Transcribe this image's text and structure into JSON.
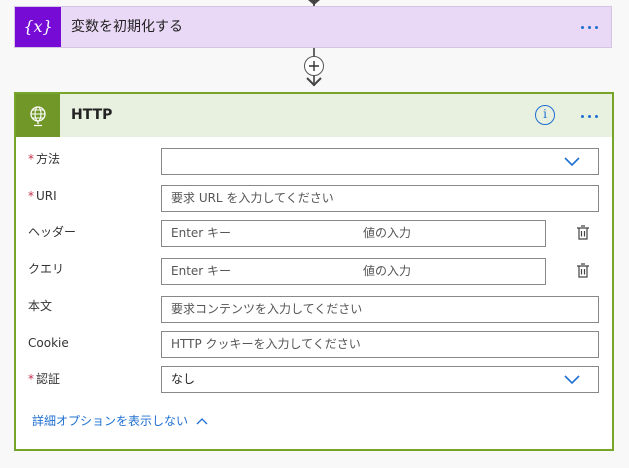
{
  "variable_card": {
    "title": "変数を初期化する",
    "icon": "variable-braces-icon",
    "accent_color": "#770bd6"
  },
  "http_card": {
    "title": "HTTP",
    "icon": "globe-icon",
    "accent_color": "#709727",
    "border_color": "#76a52a",
    "fields": {
      "method": {
        "label": "方法",
        "required": true,
        "value": ""
      },
      "uri": {
        "label": "URI",
        "required": true,
        "placeholder": "要求 URL を入力してください"
      },
      "headers": {
        "label": "ヘッダー",
        "key_placeholder": "Enter キー",
        "value_placeholder": "値の入力"
      },
      "queries": {
        "label": "クエリ",
        "key_placeholder": "Enter キー",
        "value_placeholder": "値の入力"
      },
      "body": {
        "label": "本文",
        "placeholder": "要求コンテンツを入力してください"
      },
      "cookie": {
        "label": "Cookie",
        "placeholder": "HTTP クッキーを入力してください"
      },
      "auth": {
        "label": "認証",
        "required": true,
        "value": "なし"
      }
    },
    "advanced_link": "詳細オプションを表示しない"
  },
  "required_marker": "*"
}
